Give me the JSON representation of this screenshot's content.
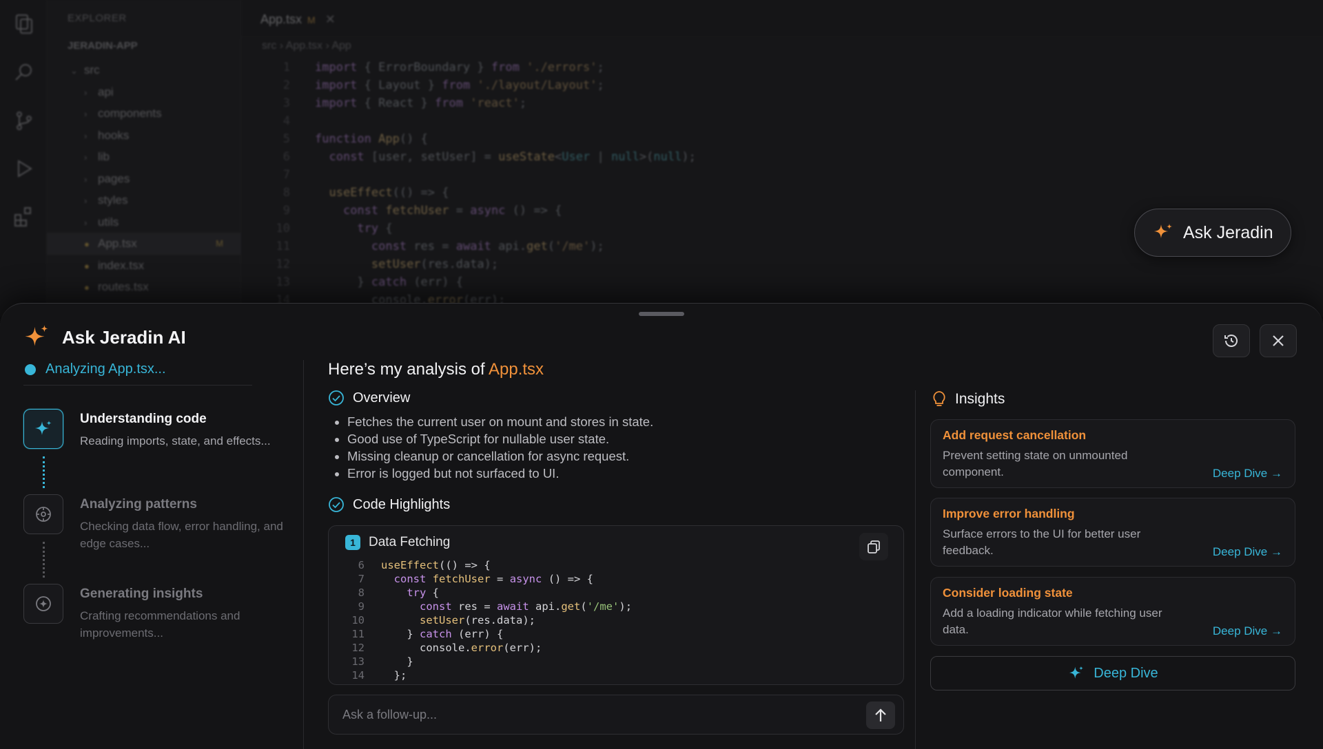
{
  "ide": {
    "explorer_header": "EXPLORER",
    "project_name": "JERADIN-APP",
    "tree": [
      {
        "label": "src",
        "indent": 1,
        "type": "folder-open"
      },
      {
        "label": "api",
        "indent": 2,
        "type": "folder"
      },
      {
        "label": "components",
        "indent": 2,
        "type": "folder"
      },
      {
        "label": "hooks",
        "indent": 2,
        "type": "folder"
      },
      {
        "label": "lib",
        "indent": 2,
        "type": "folder"
      },
      {
        "label": "pages",
        "indent": 2,
        "type": "folder"
      },
      {
        "label": "styles",
        "indent": 2,
        "type": "folder"
      },
      {
        "label": "utils",
        "indent": 2,
        "type": "folder"
      },
      {
        "label": "App.tsx",
        "indent": 2,
        "type": "file",
        "selected": true,
        "mark": "M"
      },
      {
        "label": "index.tsx",
        "indent": 2,
        "type": "file"
      },
      {
        "label": "routes.tsx",
        "indent": 2,
        "type": "file"
      }
    ],
    "tab": {
      "label": "App.tsx",
      "modified": "M",
      "close": "✕"
    },
    "breadcrumb": "src  ›  App.tsx  ›  App"
  },
  "ask_button": {
    "label": "Ask Jeradin"
  },
  "sheet": {
    "title": "Ask Jeradin AI",
    "status": "Analyzing App.tsx...",
    "steps": [
      {
        "title": "Understanding code",
        "desc": "Reading imports, state, and effects...",
        "icon": "sparkle-icon",
        "active": true
      },
      {
        "title": "Analyzing patterns",
        "desc": "Checking data flow, error handling, and edge cases...",
        "icon": "pattern-icon",
        "active": false
      },
      {
        "title": "Generating insights",
        "desc": "Crafting recommendations and improvements...",
        "icon": "insight-icon",
        "active": false
      }
    ],
    "main": {
      "heading_prefix": "Here’s my analysis of ",
      "heading_file": "App.tsx",
      "overview_title": "Overview",
      "overview_items": [
        "Fetches the current user on mount and stores in state.",
        "Good use of TypeScript for nullable user state.",
        "Missing cleanup or cancellation for async request.",
        "Error is logged but not surfaced to UI."
      ],
      "highlights_title": "Code Highlights",
      "card": {
        "badge": "1",
        "title": "Data Fetching",
        "line_numbers": [
          "6",
          "7",
          "8",
          "9",
          "10",
          "11",
          "12",
          "13",
          "14"
        ]
      },
      "followup_placeholder": "Ask a follow-up..."
    },
    "insights": {
      "title": "Insights",
      "items": [
        {
          "title": "Add request cancellation",
          "desc": "Prevent setting state on unmounted component.",
          "action": "Deep Dive →"
        },
        {
          "title": "Improve error handling",
          "desc": "Surface errors to the UI for better user feedback.",
          "action": "Deep Dive →"
        },
        {
          "title": "Consider loading state",
          "desc": "Add a loading indicator while fetching user data.",
          "action": "Deep Dive →"
        }
      ],
      "deep_dive_label": "Deep Dive"
    }
  },
  "colors": {
    "accent_orange": "#f0913a",
    "accent_cyan": "#38b6d8",
    "sheet_bg": "#141416"
  }
}
